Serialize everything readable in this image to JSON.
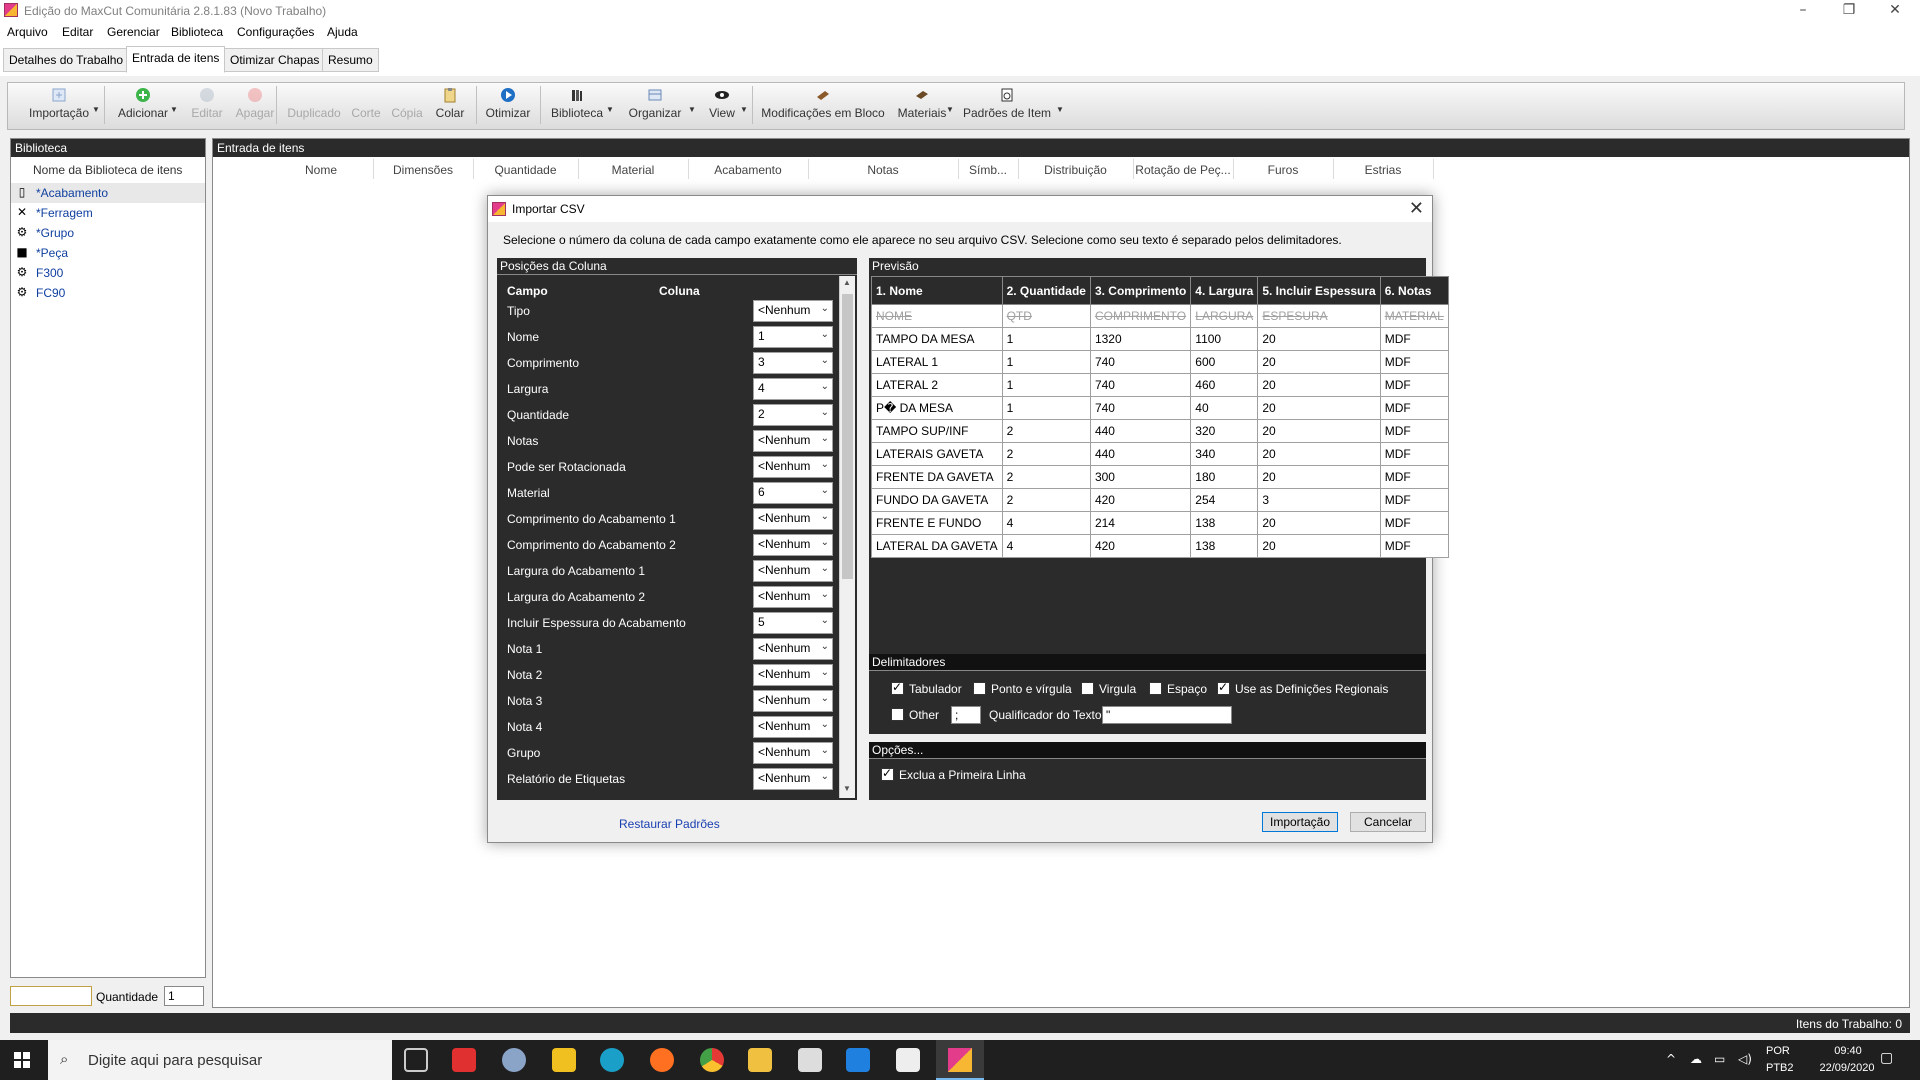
{
  "window": {
    "title": "Edição do MaxCut Comunitária 2.8.1.83 (Novo Trabalho)"
  },
  "menu": [
    "Arquivo",
    "Editar",
    "Gerenciar",
    "Biblioteca",
    "Configurações",
    "Ajuda"
  ],
  "tabs": [
    "Detalhes do Trabalho",
    "Entrada de itens",
    "Otimizar Chapas",
    "Resumo"
  ],
  "toolbar": {
    "import": "Importação",
    "add": "Adicionar",
    "edit": "Editar",
    "delete": "Apagar",
    "duplicate": "Duplicado",
    "cut": "Corte",
    "copy": "Cópia",
    "paste": "Colar",
    "optimize": "Otimizar",
    "library": "Biblioteca",
    "organize": "Organizar",
    "view": "View",
    "bulk": "Modificações em Bloco",
    "materials": "Materiais",
    "item_defaults": "Padrões de Item"
  },
  "library": {
    "header": "Biblioteca",
    "column": "Nome da Biblioteca de itens",
    "items": [
      "*Acabamento",
      "*Ferragem",
      "*Grupo",
      "*Peça",
      "F300",
      "FC90"
    ]
  },
  "items_panel": {
    "header": "Entrada de itens",
    "columns": [
      "Nome",
      "Dimensões",
      "Quantidade",
      "Material",
      "Acabamento",
      "Notas",
      "Símb...",
      "Distribuição",
      "Rotação de Peç...",
      "Furos",
      "Estrias"
    ]
  },
  "quantity": {
    "label": "Quantidade",
    "value": "1"
  },
  "status": {
    "items": "Itens do Trabalho: 0"
  },
  "dialog": {
    "title": "Importar CSV",
    "instructions": "Selecione o número da coluna de cada campo exatamente como ele aparece no seu arquivo CSV. Selecione como seu texto é separado pelos delimitadores.",
    "positions_header": "Posições da Coluna",
    "field_col": "Campo",
    "column_col": "Coluna",
    "fields": [
      {
        "name": "Tipo",
        "value": "<Nenhum"
      },
      {
        "name": "Nome",
        "value": "1"
      },
      {
        "name": "Comprimento",
        "value": "3"
      },
      {
        "name": "Largura",
        "value": "4"
      },
      {
        "name": "Quantidade",
        "value": "2"
      },
      {
        "name": "Notas",
        "value": "<Nenhum"
      },
      {
        "name": "Pode ser Rotacionada",
        "value": "<Nenhum"
      },
      {
        "name": "Material",
        "value": "6"
      },
      {
        "name": "Comprimento do Acabamento 1",
        "value": "<Nenhum"
      },
      {
        "name": "Comprimento do Acabamento 2",
        "value": "<Nenhum"
      },
      {
        "name": "Largura do Acabamento 1",
        "value": "<Nenhum"
      },
      {
        "name": "Largura do Acabamento 2",
        "value": "<Nenhum"
      },
      {
        "name": "Incluir Espessura do Acabamento",
        "value": "5"
      },
      {
        "name": "Nota 1",
        "value": "<Nenhum"
      },
      {
        "name": "Nota 2",
        "value": "<Nenhum"
      },
      {
        "name": "Nota 3",
        "value": "<Nenhum"
      },
      {
        "name": "Nota 4",
        "value": "<Nenhum"
      },
      {
        "name": "Grupo",
        "value": "<Nenhum"
      },
      {
        "name": "Relatório de Etiquetas",
        "value": "<Nenhum"
      }
    ],
    "restore": "Restaurar Padrões",
    "preview_header": "Previsão",
    "preview_columns": [
      "1. Nome",
      "2. Quantidade",
      "3. Comprimento",
      "4. Largura",
      "5. Incluir Espessura",
      "6. Notas"
    ],
    "preview_rows": [
      [
        "NOME",
        "QTD",
        "COMPRIMENTO",
        "LARGURA",
        "ESPESURA",
        "MATERIAL"
      ],
      [
        "TAMPO DA MESA",
        "1",
        "1320",
        "1100",
        "20",
        "MDF"
      ],
      [
        "LATERAL 1",
        "1",
        "740",
        "600",
        "20",
        "MDF"
      ],
      [
        "LATERAL 2",
        "1",
        "740",
        "460",
        "20",
        "MDF"
      ],
      [
        "P� DA MESA",
        "1",
        "740",
        "40",
        "20",
        "MDF"
      ],
      [
        "TAMPO SUP/INF",
        "2",
        "440",
        "320",
        "20",
        "MDF"
      ],
      [
        "LATERAIS GAVETA",
        "2",
        "440",
        "340",
        "20",
        "MDF"
      ],
      [
        "FRENTE DA GAVETA",
        "2",
        "300",
        "180",
        "20",
        "MDF"
      ],
      [
        "FUNDO DA GAVETA",
        "2",
        "420",
        "254",
        "3",
        "MDF"
      ],
      [
        "FRENTE E FUNDO",
        "4",
        "214",
        "138",
        "20",
        "MDF"
      ],
      [
        "LATERAL DA GAVETA",
        "4",
        "420",
        "138",
        "20",
        "MDF"
      ]
    ],
    "delimiters_header": "Delimitadores",
    "delim": {
      "tab": "Tabulador",
      "semicolon": "Ponto e vírgula",
      "comma": "Virgula",
      "space": "Espaço",
      "regional": "Use as Definições Regionais",
      "other": "Other",
      "other_value": ";",
      "qualifier": "Qualificador do Texto:",
      "qualifier_value": "\""
    },
    "options_header": "Opções...",
    "exclude_first": "Exclua a Primeira Linha",
    "import_btn": "Importação",
    "cancel_btn": "Cancelar"
  },
  "taskbar": {
    "search": "Digite aqui para pesquisar",
    "lang": "POR",
    "layout": "PTB2",
    "time": "09:40",
    "date": "22/09/2020"
  },
  "colors": {
    "dark": "#2b2b2b",
    "accent": "#0078d7"
  }
}
